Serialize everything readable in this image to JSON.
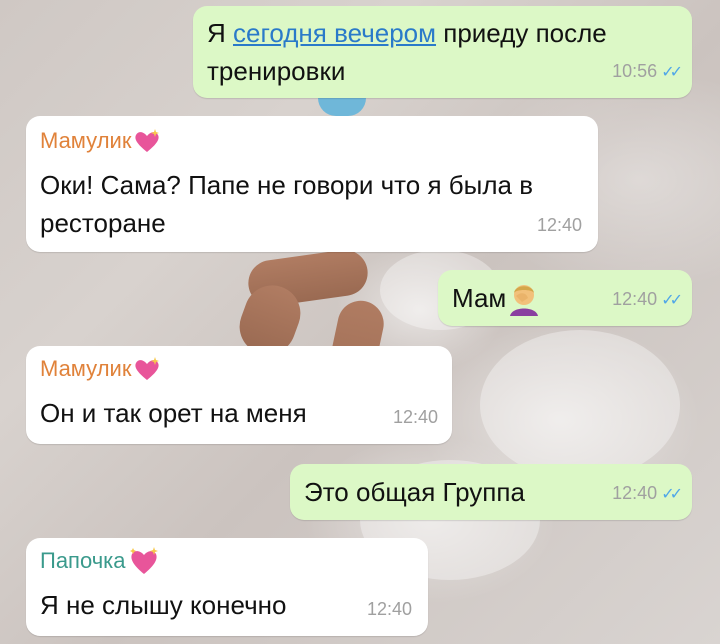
{
  "messages": [
    {
      "dir": "out",
      "parts": [
        "Я ",
        "сегодня вечером",
        " приеду после тренировки"
      ],
      "time": "10:56",
      "status": "read"
    },
    {
      "dir": "in",
      "sender": "Мамулик",
      "sender_emoji": "sparkling-heart",
      "text": "Оки! Сама? Папе не говори что я была в ресторане",
      "time": "12:40"
    },
    {
      "dir": "out",
      "text": "Мам",
      "emoji": "face-palm",
      "time": "12:40",
      "status": "read"
    },
    {
      "dir": "in",
      "sender": "Мамулик",
      "sender_emoji": "sparkling-heart",
      "text": "Он и так орет на меня",
      "time": "12:40"
    },
    {
      "dir": "out",
      "text": "Это общая Группа",
      "time": "12:40",
      "status": "read"
    },
    {
      "dir": "in",
      "sender": "Папочка",
      "sender_emoji": "sparkling-heart-sparkles",
      "text": "Я не слышу конечно",
      "time": "12:40"
    }
  ],
  "colors": {
    "incoming_bubble": "#ffffff",
    "outgoing_bubble": "#dcf8c6",
    "sender_mom": "#e0823a",
    "sender_dad": "#3a9a8c",
    "read_ticks": "#4fa6e8",
    "link": "#2a7ac9"
  }
}
